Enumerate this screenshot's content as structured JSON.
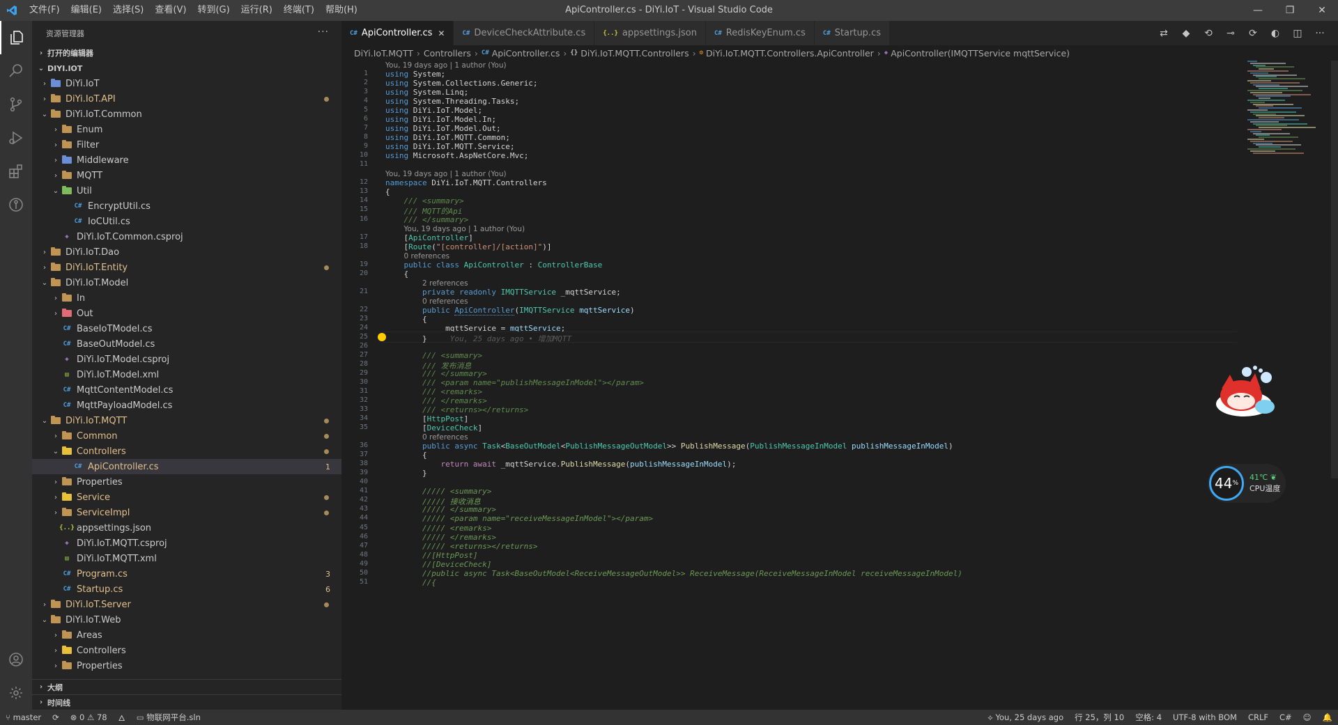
{
  "titlebar": {
    "title": "ApiController.cs - DiYi.IoT - Visual Studio Code",
    "menu": [
      "文件(F)",
      "编辑(E)",
      "选择(S)",
      "查看(V)",
      "转到(G)",
      "运行(R)",
      "终端(T)",
      "帮助(H)"
    ]
  },
  "sidebar": {
    "header": "资源管理器",
    "more": "···",
    "open_editors": "打开的编辑器",
    "workspace": "DIYI.IOT",
    "outline": "大纲",
    "timeline": "时间线"
  },
  "tree": [
    {
      "label": "DiYi.IoT",
      "level": 0,
      "type": "folder",
      "chev": "›",
      "color": "blue"
    },
    {
      "label": "DiYi.IoT.API",
      "level": 0,
      "type": "folder",
      "chev": "›",
      "mod": true,
      "dot": true
    },
    {
      "label": "DiYi.IoT.Common",
      "level": 0,
      "type": "folder",
      "chev": "⌄",
      "open": true
    },
    {
      "label": "Enum",
      "level": 1,
      "type": "folder",
      "chev": "›"
    },
    {
      "label": "Filter",
      "level": 1,
      "type": "folder",
      "chev": "›"
    },
    {
      "label": "Middleware",
      "level": 1,
      "type": "folder",
      "chev": "›",
      "color": "blue"
    },
    {
      "label": "MQTT",
      "level": 1,
      "type": "folder",
      "chev": "›"
    },
    {
      "label": "Util",
      "level": 1,
      "type": "folder",
      "chev": "⌄",
      "color": "green"
    },
    {
      "label": "EncryptUtil.cs",
      "level": 2,
      "type": "cs"
    },
    {
      "label": "IoCUtil.cs",
      "level": 2,
      "type": "cs"
    },
    {
      "label": "DiYi.IoT.Common.csproj",
      "level": 1,
      "type": "csproj"
    },
    {
      "label": "DiYi.IoT.Dao",
      "level": 0,
      "type": "folder",
      "chev": "›"
    },
    {
      "label": "DiYi.IoT.Entity",
      "level": 0,
      "type": "folder",
      "chev": "›",
      "mod": true,
      "dot": true
    },
    {
      "label": "DiYi.IoT.Model",
      "level": 0,
      "type": "folder",
      "chev": "⌄",
      "open": true
    },
    {
      "label": "In",
      "level": 1,
      "type": "folder",
      "chev": "›"
    },
    {
      "label": "Out",
      "level": 1,
      "type": "folder",
      "chev": "›",
      "color": "red"
    },
    {
      "label": "BaseIoTModel.cs",
      "level": 1,
      "type": "cs"
    },
    {
      "label": "BaseOutModel.cs",
      "level": 1,
      "type": "cs"
    },
    {
      "label": "DiYi.IoT.Model.csproj",
      "level": 1,
      "type": "csproj"
    },
    {
      "label": "DiYi.IoT.Model.xml",
      "level": 1,
      "type": "xml"
    },
    {
      "label": "MqttContentModel.cs",
      "level": 1,
      "type": "cs"
    },
    {
      "label": "MqttPayloadModel.cs",
      "level": 1,
      "type": "cs"
    },
    {
      "label": "DiYi.IoT.MQTT",
      "level": 0,
      "type": "folder",
      "chev": "⌄",
      "open": true,
      "mod": true,
      "dot": true
    },
    {
      "label": "Common",
      "level": 1,
      "type": "folder",
      "chev": "›",
      "mod": true,
      "dot": true
    },
    {
      "label": "Controllers",
      "level": 1,
      "type": "folder",
      "chev": "⌄",
      "color": "yellow",
      "mod": true,
      "dot": true
    },
    {
      "label": "ApiController.cs",
      "level": 2,
      "type": "cs",
      "selected": true,
      "badge": "1"
    },
    {
      "label": "Properties",
      "level": 1,
      "type": "folder",
      "chev": "›"
    },
    {
      "label": "Service",
      "level": 1,
      "type": "folder",
      "chev": "›",
      "color": "yellow",
      "mod": true,
      "dot": true
    },
    {
      "label": "ServiceImpl",
      "level": 1,
      "type": "folder",
      "chev": "›",
      "mod": true,
      "dot": true
    },
    {
      "label": "appsettings.json",
      "level": 1,
      "type": "json"
    },
    {
      "label": "DiYi.IoT.MQTT.csproj",
      "level": 1,
      "type": "csproj"
    },
    {
      "label": "DiYi.IoT.MQTT.xml",
      "level": 1,
      "type": "xml"
    },
    {
      "label": "Program.cs",
      "level": 1,
      "type": "cs",
      "mod": true,
      "badge": "3"
    },
    {
      "label": "Startup.cs",
      "level": 1,
      "type": "cs",
      "mod": true,
      "badge": "6"
    },
    {
      "label": "DiYi.IoT.Server",
      "level": 0,
      "type": "folder",
      "chev": "›",
      "mod": true,
      "dot": true
    },
    {
      "label": "DiYi.IoT.Web",
      "level": 0,
      "type": "folder",
      "chev": "⌄",
      "open": true
    },
    {
      "label": "Areas",
      "level": 1,
      "type": "folder",
      "chev": "›"
    },
    {
      "label": "Controllers",
      "level": 1,
      "type": "folder",
      "chev": "›",
      "color": "yellow"
    },
    {
      "label": "Properties",
      "level": 1,
      "type": "folder",
      "chev": "›"
    }
  ],
  "tabs": [
    {
      "label": "ApiController.cs",
      "icon": "C#",
      "active": true
    },
    {
      "label": "DeviceCheckAttribute.cs",
      "icon": "C#"
    },
    {
      "label": "appsettings.json",
      "icon": "{..}"
    },
    {
      "label": "RedisKeyEnum.cs",
      "icon": "C#"
    },
    {
      "label": "Startup.cs",
      "icon": "C#"
    }
  ],
  "breadcrumbs": [
    {
      "label": "DiYi.IoT.MQTT"
    },
    {
      "label": "Controllers"
    },
    {
      "label": "ApiController.cs",
      "icon": "C#",
      "cls": ""
    },
    {
      "label": "DiYi.IoT.MQTT.Controllers",
      "icon": "{}",
      "cls": "ns"
    },
    {
      "label": "DiYi.IoT.MQTT.Controllers.ApiController",
      "icon": "⚙",
      "cls": "cls"
    },
    {
      "label": "ApiController(IMQTTService mqttService)",
      "icon": "◈",
      "cls": "mth"
    }
  ],
  "code": [
    {
      "t": "lens",
      "text": "You, 19 days ago | 1 author (You)"
    },
    {
      "n": "1",
      "h": "<span class='kw'>using</span> System;"
    },
    {
      "n": "2",
      "h": "<span class='kw'>using</span> System.Collections.Generic;"
    },
    {
      "n": "3",
      "h": "<span class='kw'>using</span> System.Linq;"
    },
    {
      "n": "4",
      "h": "<span class='kw'>using</span> System.Threading.Tasks;"
    },
    {
      "n": "5",
      "h": "<span class='kw'>using</span> DiYi.IoT.Model;"
    },
    {
      "n": "6",
      "h": "<span class='kw'>using</span> DiYi.IoT.Model.In;"
    },
    {
      "n": "7",
      "h": "<span class='kw'>using</span> DiYi.IoT.Model.Out;"
    },
    {
      "n": "8",
      "h": "<span class='kw'>using</span> DiYi.IoT.MQTT.Common;"
    },
    {
      "n": "9",
      "h": "<span class='kw'>using</span> DiYi.IoT.MQTT.Service;"
    },
    {
      "n": "10",
      "h": "<span class='kw'>using</span> Microsoft.AspNetCore.Mvc;"
    },
    {
      "n": "11",
      "h": ""
    },
    {
      "t": "lens",
      "text": "You, 19 days ago | 1 author (You)"
    },
    {
      "n": "12",
      "h": "<span class='kw'>namespace</span> DiYi.IoT.MQTT.Controllers"
    },
    {
      "n": "13",
      "h": "{"
    },
    {
      "n": "14",
      "h": "    <span class='xml'>/// &lt;summary&gt;</span>"
    },
    {
      "n": "15",
      "h": "    <span class='xml'>/// MQTT的Api</span>"
    },
    {
      "n": "16",
      "h": "    <span class='xml'>/// &lt;/summary&gt;</span>"
    },
    {
      "t": "lens",
      "indent": "    ",
      "text": "You, 19 days ago | 1 author (You)"
    },
    {
      "n": "17",
      "h": "    [<span class='ty'>ApiController</span>]"
    },
    {
      "n": "18",
      "h": "    [<span class='ty'>Route</span>(<span class='str'>\"[controller]/[action]\"</span>)]"
    },
    {
      "t": "lens",
      "indent": "    ",
      "text": "0 references"
    },
    {
      "n": "19",
      "h": "    <span class='kw'>public class</span> <span class='ty'>ApiController</span> : <span class='ty'>ControllerBase</span>"
    },
    {
      "n": "20",
      "h": "    {"
    },
    {
      "t": "lens",
      "indent": "        ",
      "text": "2 references"
    },
    {
      "n": "21",
      "h": "        <span class='kw'>private readonly</span> <span class='ty'>IMQTTService</span> _mqttService;"
    },
    {
      "t": "lens",
      "indent": "        ",
      "text": "0 references"
    },
    {
      "n": "22",
      "h": "        <span class='kw'>public</span> <span class='sq'>ApiController</span>(<span class='ty'>IMQTTService</span> <span class='par'>mqttService</span>)"
    },
    {
      "n": "23",
      "h": "        {"
    },
    {
      "n": "24",
      "h": "            _mqttService = <span class='par'>mqttService</span>;"
    },
    {
      "n": "25",
      "h": "        }     <span class='ghost'>You, 25 days ago • 增加MQTT</span>",
      "current": true
    },
    {
      "n": "26",
      "h": ""
    },
    {
      "n": "27",
      "h": "        <span class='xml'>/// &lt;summary&gt;</span>"
    },
    {
      "n": "28",
      "h": "        <span class='xml'>/// 发布消息</span>"
    },
    {
      "n": "29",
      "h": "        <span class='xml'>/// &lt;/summary&gt;</span>"
    },
    {
      "n": "30",
      "h": "        <span class='xml'>/// &lt;param name=\"publishMessageInModel\"&gt;&lt;/param&gt;</span>"
    },
    {
      "n": "31",
      "h": "        <span class='xml'>/// &lt;remarks&gt;</span>"
    },
    {
      "n": "32",
      "h": "        <span class='xml'>/// &lt;/remarks&gt;</span>"
    },
    {
      "n": "33",
      "h": "        <span class='xml'>/// &lt;returns&gt;&lt;/returns&gt;</span>"
    },
    {
      "n": "34",
      "h": "        [<span class='ty'>HttpPost</span>]"
    },
    {
      "n": "35",
      "h": "        [<span class='ty'>DeviceCheck</span>]"
    },
    {
      "t": "lens",
      "indent": "        ",
      "text": "0 references"
    },
    {
      "n": "36",
      "h": "        <span class='kw'>public async</span> <span class='ty'>Task</span>&lt;<span class='ty'>BaseOutModel</span>&lt;<span class='ty'>PublishMessageOutModel</span>&gt;&gt; <span class='fn'>PublishMessage</span>(<span class='ty'>PublishMessageInModel</span> <span class='par'>publishMessageInModel</span>)"
    },
    {
      "n": "37",
      "h": "        {"
    },
    {
      "n": "38",
      "h": "            <span class='ctl'>return await</span> _mqttService.<span class='fn'>PublishMessage</span>(<span class='par'>publishMessageInModel</span>);"
    },
    {
      "n": "39",
      "h": "        }"
    },
    {
      "n": "40",
      "h": ""
    },
    {
      "n": "41",
      "h": "        <span class='cm'>///// &lt;summary&gt;</span>"
    },
    {
      "n": "42",
      "h": "        <span class='cm'>///// 接收消息</span>"
    },
    {
      "n": "43",
      "h": "        <span class='cm'>///// &lt;/summary&gt;</span>"
    },
    {
      "n": "44",
      "h": "        <span class='cm'>///// &lt;param name=\"receiveMessageInModel\"&gt;&lt;/param&gt;</span>"
    },
    {
      "n": "45",
      "h": "        <span class='cm'>///// &lt;remarks&gt;</span>"
    },
    {
      "n": "46",
      "h": "        <span class='cm'>///// &lt;/remarks&gt;</span>"
    },
    {
      "n": "47",
      "h": "        <span class='cm'>///// &lt;returns&gt;&lt;/returns&gt;</span>"
    },
    {
      "n": "48",
      "h": "        <span class='cm'>//[HttpPost]</span>"
    },
    {
      "n": "49",
      "h": "        <span class='cm'>//[DeviceCheck]</span>"
    },
    {
      "n": "50",
      "h": "        <span class='cm'>//public async Task&lt;BaseOutModel&lt;ReceiveMessageOutModel&gt;&gt; ReceiveMessage(ReceiveMessageInModel receiveMessageInModel)</span>"
    },
    {
      "n": "51",
      "h": "        <span class='cm'>//{</span>"
    }
  ],
  "cpu": {
    "percent": "44",
    "unit": "%",
    "temp": "41℃",
    "label": "CPU温度"
  },
  "status": {
    "branch": "master",
    "sync": "⟳",
    "problems": "⊗ 0 ⚠ 78",
    "fire": "🜂",
    "solution": "物联网平台.sln",
    "blame": "You, 25 days ago",
    "position": "行 25，列 10",
    "spaces": "空格: 4",
    "encoding": "UTF-8 with BOM",
    "eol": "CRLF",
    "lang": "C#"
  }
}
